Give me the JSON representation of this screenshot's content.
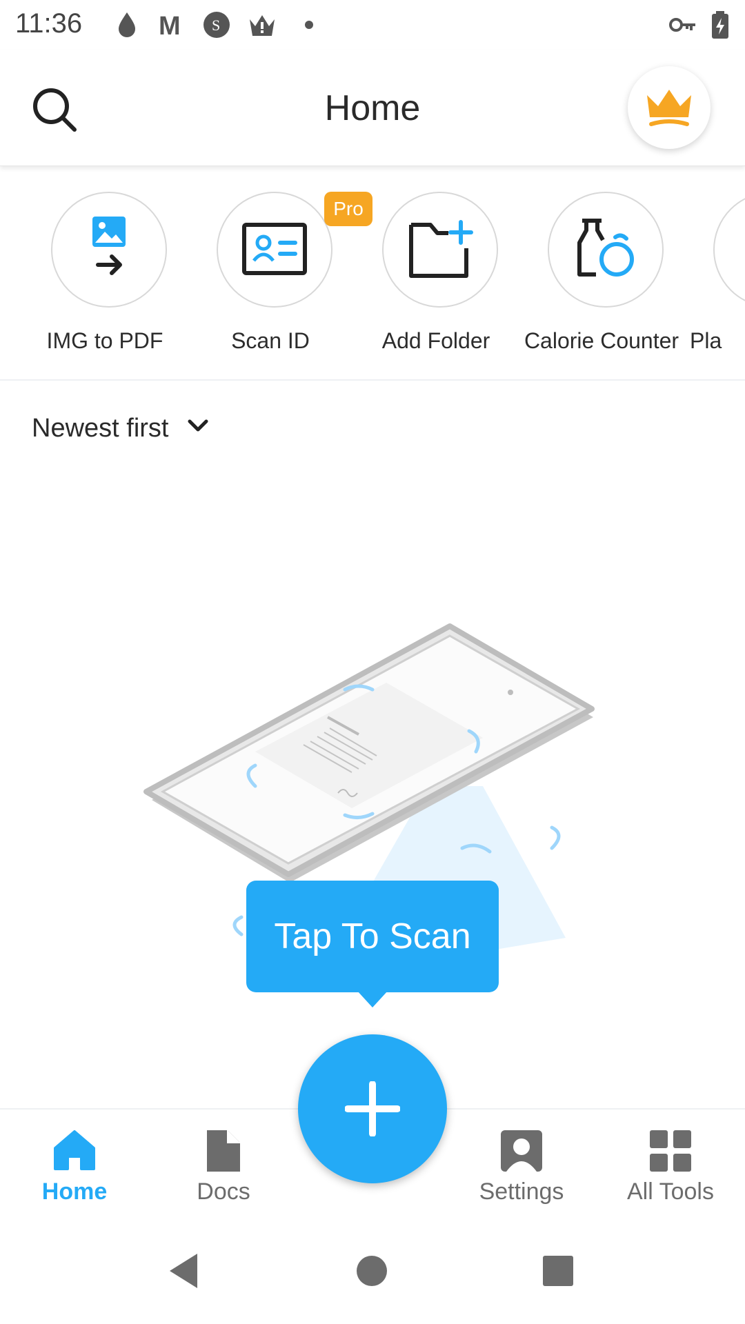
{
  "status_bar": {
    "time": "11:36",
    "left_icons": [
      "water-drop-icon",
      "gmail-m-icon",
      "s-badge-icon",
      "crown-alert-icon",
      "dot-icon"
    ],
    "right_icons": [
      "vpn-key-icon",
      "battery-charging-icon"
    ]
  },
  "header": {
    "title": "Home",
    "search_icon": "search-icon",
    "premium_icon": "crown-icon"
  },
  "quick_tools": [
    {
      "label": "IMG to PDF",
      "icon": "image-to-pdf-icon"
    },
    {
      "label": "Scan ID",
      "icon": "id-card-icon",
      "badge": "Pro"
    },
    {
      "label": "Add Folder",
      "icon": "add-folder-icon"
    },
    {
      "label": "Calorie Counter",
      "icon": "calorie-counter-icon"
    },
    {
      "label": "Pla",
      "icon": "plan-icon"
    }
  ],
  "sort": {
    "label": "Newest first",
    "icon": "chevron-down-icon"
  },
  "tooltip": {
    "text": "Tap To Scan"
  },
  "bottom_nav": {
    "items": [
      {
        "label": "Home",
        "icon": "home-icon",
        "active": true
      },
      {
        "label": "Docs",
        "icon": "document-icon",
        "active": false
      },
      {
        "label": "Settings",
        "icon": "profile-icon",
        "active": false
      },
      {
        "label": "All Tools",
        "icon": "grid-icon",
        "active": false
      }
    ],
    "fab_icon": "plus-icon"
  },
  "colors": {
    "accent": "#24aaf6",
    "pro_badge": "#f6a623",
    "crown": "#f6a623",
    "inactive": "#6c6c6c"
  },
  "system_nav": [
    "back-icon",
    "home-circle-icon",
    "recents-icon"
  ]
}
